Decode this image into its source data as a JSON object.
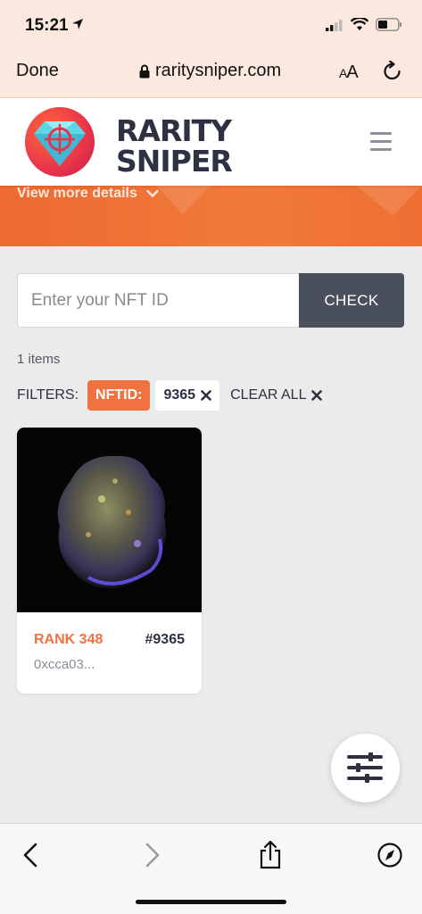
{
  "status_bar": {
    "time": "15:21",
    "icons": [
      "location-arrow-icon",
      "cellular-signal-icon",
      "wifi-icon",
      "battery-icon"
    ]
  },
  "browser": {
    "done_label": "Done",
    "url": "raritysniper.com",
    "text_size_label_small": "A",
    "text_size_label_large": "A"
  },
  "site_header": {
    "brand_line1": "RARITY",
    "brand_line2": "SNIPER"
  },
  "hero": {
    "view_more_label": "View more details"
  },
  "search": {
    "placeholder": "Enter your NFT ID",
    "value": "",
    "check_label": "CHECK"
  },
  "results": {
    "count_label": "1 items"
  },
  "filters": {
    "label": "FILTERS:",
    "chip_key": "NFTID:",
    "chip_value": "9365",
    "clear_all_label": "CLEAR ALL"
  },
  "cards": [
    {
      "rank_label": "RANK 348",
      "id_label": "#9365",
      "owner": "0xcca03..."
    }
  ],
  "colors": {
    "accent_orange": "#ef7240",
    "dark_slate": "#2d3142",
    "check_button": "#4a4f5c",
    "browser_chrome": "#fbe8de"
  }
}
